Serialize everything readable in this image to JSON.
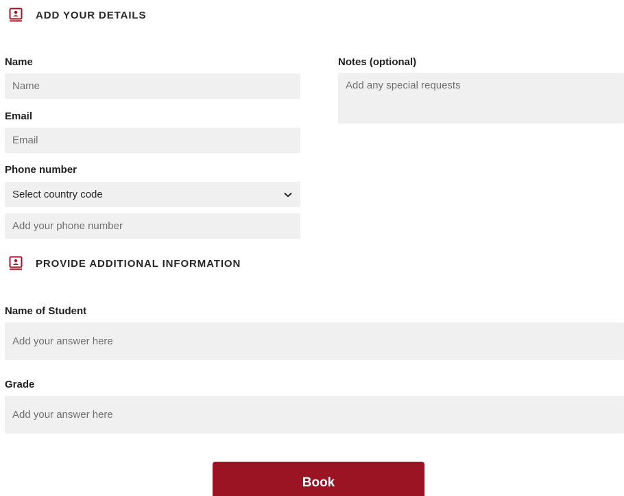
{
  "section_details": {
    "title": "ADD YOUR DETAILS",
    "icon": "contact-book-icon"
  },
  "form": {
    "name": {
      "label": "Name",
      "placeholder": "Name"
    },
    "email": {
      "label": "Email",
      "placeholder": "Email"
    },
    "phone": {
      "label": "Phone number",
      "country_select_value": "Select country code",
      "placeholder": "Add your phone number"
    },
    "notes": {
      "label": "Notes (optional)",
      "placeholder": "Add any special requests"
    }
  },
  "section_additional": {
    "title": "PROVIDE ADDITIONAL INFORMATION",
    "icon": "contact-book-icon"
  },
  "additional": {
    "student_name": {
      "label": "Name of Student",
      "placeholder": "Add your answer here"
    },
    "grade": {
      "label": "Grade",
      "placeholder": "Add your answer here"
    }
  },
  "actions": {
    "book_label": "Book"
  },
  "colors": {
    "accent": "#9b1424",
    "field_background": "#f0f0f0",
    "placeholder_text": "#6f6f6f"
  }
}
